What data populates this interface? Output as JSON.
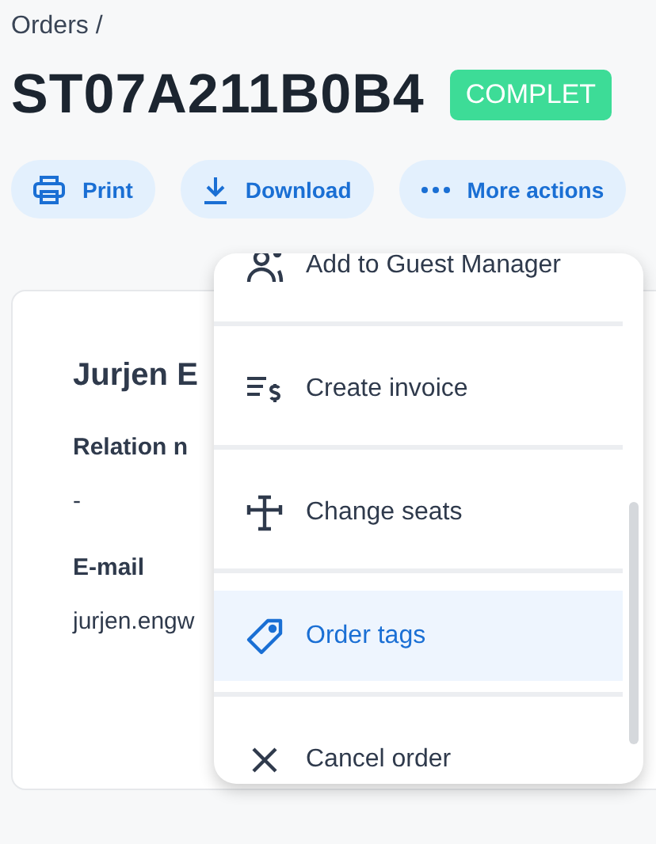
{
  "breadcrumb": "Orders /",
  "order": {
    "number": "ST07A211B0B4",
    "status": "COMPLET"
  },
  "actions": [
    {
      "kind": "print",
      "label": "Print"
    },
    {
      "kind": "download",
      "label": "Download"
    },
    {
      "kind": "more",
      "label": "More actions"
    }
  ],
  "card": {
    "name": "Jurjen E",
    "fields": [
      {
        "label": "Relation n",
        "value": "-"
      },
      {
        "label": "E-mail",
        "value": "jurjen.engw"
      }
    ]
  },
  "menu": [
    {
      "kind": "guests",
      "label": "Add to Guest Manager",
      "selected": false
    },
    {
      "kind": "invoice",
      "label": "Create invoice",
      "selected": false
    },
    {
      "kind": "seats",
      "label": "Change seats",
      "selected": false
    },
    {
      "kind": "tags",
      "label": "Order tags",
      "selected": true
    },
    {
      "kind": "cancel",
      "label": "Cancel order",
      "selected": false
    }
  ]
}
